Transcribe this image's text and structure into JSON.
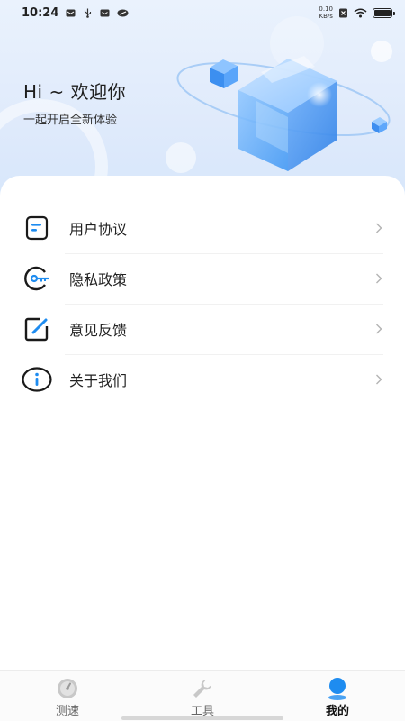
{
  "status_bar": {
    "time": "10:24",
    "net_speed_value": "0.10",
    "net_speed_unit": "KB/s"
  },
  "header": {
    "greeting": "Hi ~ 欢迎你",
    "subtitle": "一起开启全新体验"
  },
  "menu": {
    "items": [
      {
        "label": "用户协议",
        "icon": "document-icon"
      },
      {
        "label": "隐私政策",
        "icon": "privacy-key-icon"
      },
      {
        "label": "意见反馈",
        "icon": "edit-icon"
      },
      {
        "label": "关于我们",
        "icon": "info-icon"
      }
    ]
  },
  "bottom_nav": {
    "tabs": [
      {
        "label": "测速",
        "icon": "speedometer-icon"
      },
      {
        "label": "工具",
        "icon": "wrench-icon"
      },
      {
        "label": "我的",
        "icon": "profile-icon",
        "active": true
      }
    ]
  },
  "colors": {
    "accent": "#1e8cf0",
    "icon_dark": "#1a1a1a",
    "header_bg": "#e3edfb",
    "nav_inactive": "#c8c8c8"
  },
  "battery_level": 1.0
}
